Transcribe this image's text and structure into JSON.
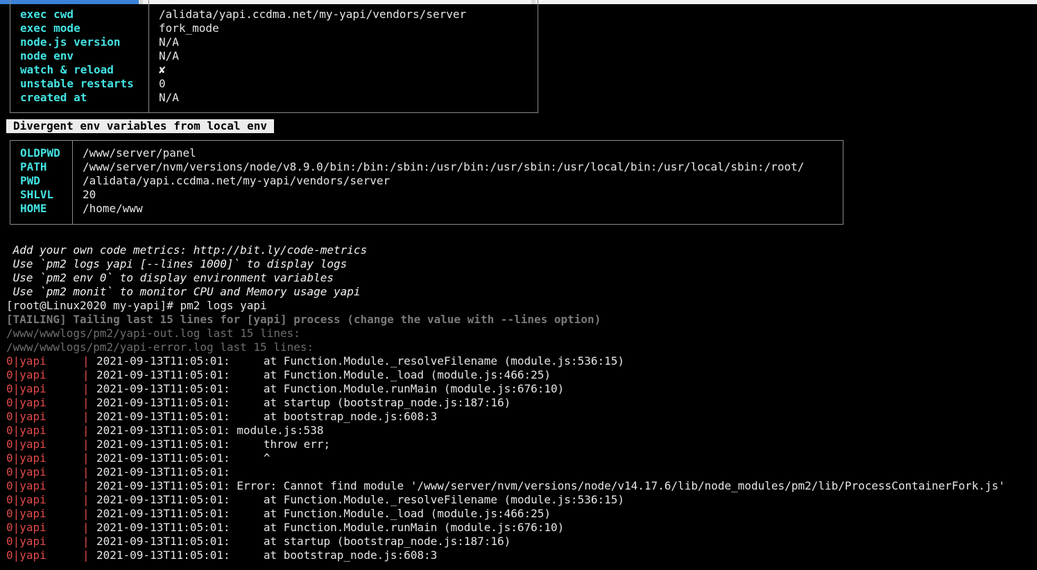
{
  "process_info": [
    {
      "key": "exec cwd",
      "value": "/alidata/yapi.ccdma.net/my-yapi/vendors/server"
    },
    {
      "key": "exec mode",
      "value": "fork_mode"
    },
    {
      "key": "node.js version",
      "value": "N/A"
    },
    {
      "key": "node env",
      "value": "N/A"
    },
    {
      "key": "watch & reload",
      "value": "✘"
    },
    {
      "key": "unstable restarts",
      "value": "0"
    },
    {
      "key": "created at",
      "value": "N/A"
    }
  ],
  "env_section_title": "Divergent env variables from local env",
  "env_vars": [
    {
      "key": "OLDPWD",
      "value": "/www/server/panel"
    },
    {
      "key": "PATH",
      "value": "/www/server/nvm/versions/node/v8.9.0/bin:/bin:/sbin:/usr/bin:/usr/sbin:/usr/local/bin:/usr/local/sbin:/root/"
    },
    {
      "key": "PWD",
      "value": "/alidata/yapi.ccdma.net/my-yapi/vendors/server"
    },
    {
      "key": "SHLVL",
      "value": "20"
    },
    {
      "key": "HOME",
      "value": "/home/www"
    }
  ],
  "tips": [
    " Add your own code metrics: http://bit.ly/code-metrics",
    " Use `pm2 logs yapi [--lines 1000]` to display logs",
    " Use `pm2 env 0` to display environment variables",
    " Use `pm2 monit` to monitor CPU and Memory usage yapi"
  ],
  "prompt": "[root@Linux2020 my-yapi]# pm2 logs yapi",
  "tailing_line": "[TAILING] Tailing last 15 lines for [yapi] process (change the value with --lines option)",
  "out_log_line": "/www/wwwlogs/pm2/yapi-out.log last 15 lines:",
  "err_log_line": "/www/wwwlogs/pm2/yapi-error.log last 15 lines:",
  "log_prefix": "0|yapi",
  "log_pipe": "|",
  "log_lines": [
    "2021-09-13T11:05:01:     at Function.Module._resolveFilename (module.js:536:15)",
    "2021-09-13T11:05:01:     at Function.Module._load (module.js:466:25)",
    "2021-09-13T11:05:01:     at Function.Module.runMain (module.js:676:10)",
    "2021-09-13T11:05:01:     at startup (bootstrap_node.js:187:16)",
    "2021-09-13T11:05:01:     at bootstrap_node.js:608:3",
    "2021-09-13T11:05:01: module.js:538",
    "2021-09-13T11:05:01:     throw err;",
    "2021-09-13T11:05:01:     ^",
    "2021-09-13T11:05:01:",
    "2021-09-13T11:05:01: Error: Cannot find module '/www/server/nvm/versions/node/v14.17.6/lib/node_modules/pm2/lib/ProcessContainerFork.js'",
    "2021-09-13T11:05:01:     at Function.Module._resolveFilename (module.js:536:15)",
    "2021-09-13T11:05:01:     at Function.Module._load (module.js:466:25)",
    "2021-09-13T11:05:01:     at Function.Module.runMain (module.js:676:10)",
    "2021-09-13T11:05:01:     at startup (bootstrap_node.js:187:16)",
    "2021-09-13T11:05:01:     at bootstrap_node.js:608:3"
  ],
  "colors": {
    "background": "#000000",
    "key_cyan": "#43e3e3",
    "log_prefix_red": "#e24a4a",
    "dim_gray": "#6e6e6e",
    "tab_active": "#3c82d8"
  }
}
